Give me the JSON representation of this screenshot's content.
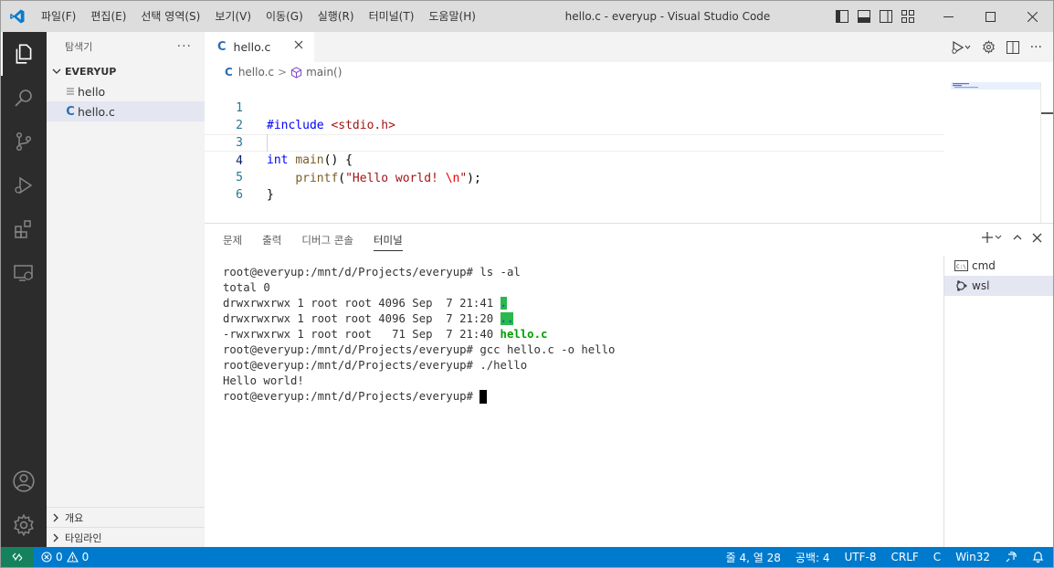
{
  "window": {
    "title": "hello.c - everyup - Visual Studio Code",
    "menu": [
      "파일(F)",
      "편집(E)",
      "선택 영역(S)",
      "보기(V)",
      "이동(G)",
      "실행(R)",
      "터미널(T)",
      "도움말(H)"
    ]
  },
  "sidebar": {
    "header": "탐색기",
    "more": "···",
    "folder": "EVERYUP",
    "files": [
      {
        "name": "hello",
        "icon": "lines-icon",
        "selected": false
      },
      {
        "name": "hello.c",
        "icon": "c-file-icon",
        "selected": true
      }
    ],
    "sections": [
      "개요",
      "타임라인"
    ]
  },
  "editor": {
    "tab": {
      "label": "hello.c",
      "icon": "C"
    },
    "breadcrumb": {
      "file": "hello.c",
      "symbol": "main()"
    },
    "lines": [
      {
        "num": "1",
        "text": "#include <stdio.h>"
      },
      {
        "num": "2",
        "text": ""
      },
      {
        "num": "3",
        "text": "int main() {"
      },
      {
        "num": "4",
        "text": "    printf(\"Hello world! \\n\");"
      },
      {
        "num": "5",
        "text": "}"
      },
      {
        "num": "6",
        "text": ""
      }
    ],
    "current_line": 4
  },
  "panel": {
    "tabs": [
      "문제",
      "출력",
      "디버그 콘솔",
      "터미널"
    ],
    "active_tab": "터미널",
    "terminal_lines": {
      "l1": "root@everyup:/mnt/d/Projects/everyup# ls -al",
      "l2": "total 0",
      "l3a": "drwxrwxrwx 1 root root 4096 Sep  7 21:41 ",
      "l3b": ".",
      "l4a": "drwxrwxrwx 1 root root 4096 Sep  7 21:20 ",
      "l4b": "..",
      "l5a": "-rwxrwxrwx 1 root root   71 Sep  7 21:40 ",
      "l5b": "hello.c",
      "l6": "root@everyup:/mnt/d/Projects/everyup# gcc hello.c -o hello",
      "l7": "root@everyup:/mnt/d/Projects/everyup# ./hello",
      "l8": "Hello world!",
      "l9": "root@everyup:/mnt/d/Projects/everyup# "
    },
    "terminals": [
      {
        "name": "cmd",
        "icon": "cmd-icon",
        "selected": false
      },
      {
        "name": "wsl",
        "icon": "linux-icon",
        "selected": true
      }
    ]
  },
  "statusbar": {
    "errors": "0",
    "warnings": "0",
    "position": "줄 4, 열 28",
    "indent": "공백: 4",
    "encoding": "UTF-8",
    "eol": "CRLF",
    "language": "C",
    "platform": "Win32"
  },
  "colors": {
    "activity_bar": "#2c2c2c",
    "status_bar": "#007acc",
    "remote": "#16825d",
    "accent": "#007acc"
  }
}
